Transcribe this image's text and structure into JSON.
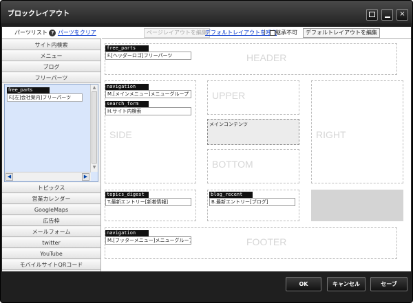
{
  "window": {
    "title": "ブロックレイアウト",
    "close_glyph": "×"
  },
  "left_panel": {
    "header_label": "パーツリスト",
    "help_glyph": "?",
    "clear_link": "パーツをクリア",
    "items_top": [
      "サイト内検索",
      "メニュー",
      "ブログ",
      "フリーパーツ"
    ],
    "selected_part": {
      "tag": "free_parts",
      "label": "F.[左]会社案内]フリーパーツ"
    },
    "items_bottom": [
      "トピックス",
      "営業カレンダー",
      "GoogleMaps",
      "広告枠",
      "メールフォーム",
      "twitter",
      "YouTube",
      "モバイルサイトQRコード"
    ]
  },
  "toolbar": {
    "edit_page_layout": "ページレイアウトを編集",
    "call_default": "デフォルトレイアウトを呼出",
    "separator": "|",
    "no_inherit": "継承不可",
    "edit_default": "デフォルトレイアウトを編集"
  },
  "regions": {
    "header": "HEADER",
    "side": "SIDE",
    "upper": "UPPER",
    "bottom": "BOTTOM",
    "right": "RIGHT",
    "footer": "FOOTER",
    "main_content": "メインコンテンツ"
  },
  "parts": {
    "header_free": {
      "tag": "free_parts",
      "label": "F.[ヘッダーロゴ]フリーパーツ"
    },
    "side_nav": {
      "tag": "navigation",
      "label": "M.[メインメニュー]メニューグループ"
    },
    "side_search": {
      "tag": "search_form",
      "label": "H.サイト内検索"
    },
    "topics": {
      "tag": "topics_digest",
      "label": "T.最新エントリー[新着情報]"
    },
    "blog": {
      "tag": "blog_recent",
      "label": "B.最新エントリー[ブログ]"
    },
    "footer_nav": {
      "tag": "navigation",
      "label": "M.[フッターメニュー]メニューグループ"
    }
  },
  "buttons": {
    "ok": "OK",
    "cancel": "キャンセル",
    "save": "セーブ"
  }
}
